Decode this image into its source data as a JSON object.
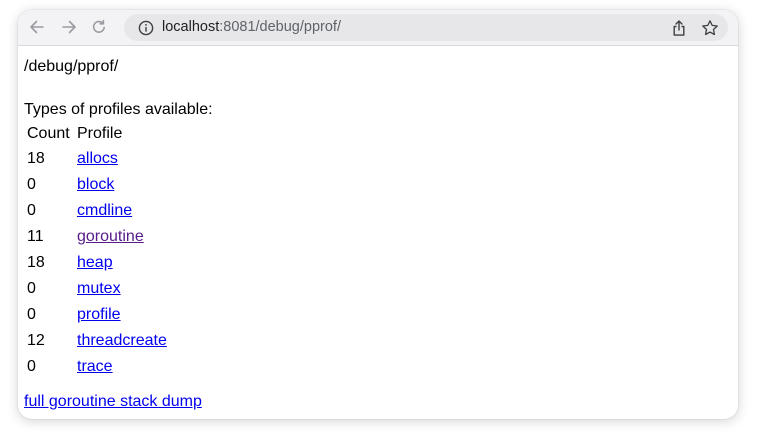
{
  "browser": {
    "url_host": "localhost",
    "url_rest": ":8081/debug/pprof/",
    "icons": {
      "back": "arrow-left-icon",
      "forward": "arrow-right-icon",
      "reload": "reload-icon",
      "site_info": "info-icon",
      "share": "share-icon",
      "bookmark": "star-icon"
    }
  },
  "page": {
    "title": "/debug/pprof/",
    "types_label": "Types of profiles available:",
    "table": {
      "headers": [
        "Count",
        "Profile"
      ],
      "rows": [
        {
          "count": "18",
          "profile": "allocs",
          "visited": false
        },
        {
          "count": "0",
          "profile": "block",
          "visited": false
        },
        {
          "count": "0",
          "profile": "cmdline",
          "visited": false
        },
        {
          "count": "11",
          "profile": "goroutine",
          "visited": true
        },
        {
          "count": "18",
          "profile": "heap",
          "visited": false
        },
        {
          "count": "0",
          "profile": "mutex",
          "visited": false
        },
        {
          "count": "0",
          "profile": "profile",
          "visited": false
        },
        {
          "count": "12",
          "profile": "threadcreate",
          "visited": false
        },
        {
          "count": "0",
          "profile": "trace",
          "visited": false
        }
      ]
    },
    "dump_link": "full goroutine stack dump"
  },
  "colors": {
    "link": "#0000ee",
    "visited_link": "#551a8b",
    "toolbar_bg": "#f3f3f5",
    "omnibox_bg": "#e7e7ea"
  }
}
